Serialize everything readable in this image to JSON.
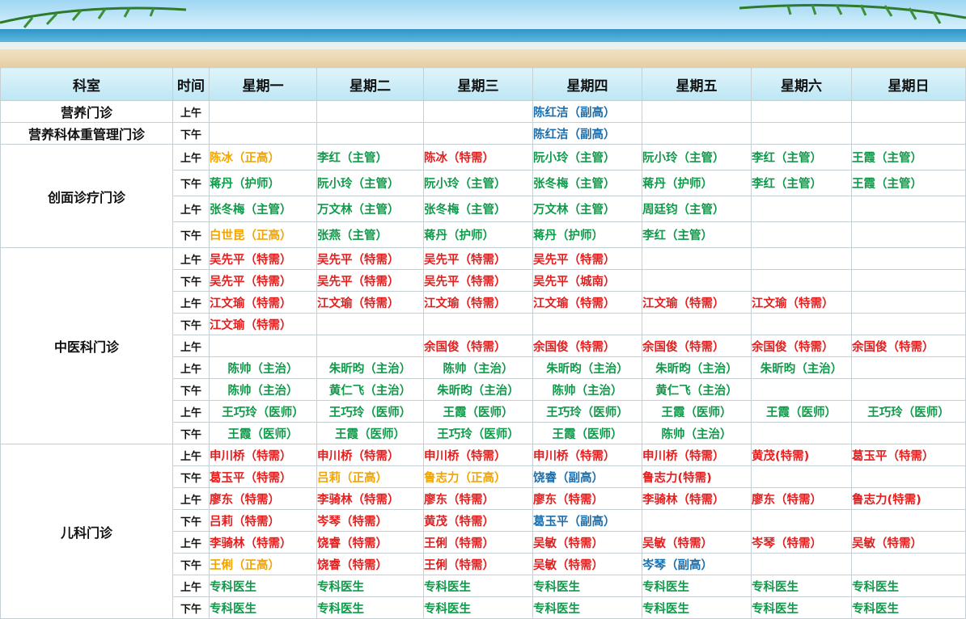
{
  "header": {
    "dept": "科室",
    "time": "时间",
    "days": [
      "星期一",
      "星期二",
      "星期三",
      "星期四",
      "星期五",
      "星期六",
      "星期日"
    ]
  },
  "colors": {
    "red": "#e51e1e",
    "green": "#0f9a4a",
    "gold": "#f2a500",
    "blue": "#1c6fad"
  },
  "departments": [
    {
      "name": "营养门诊",
      "rows": [
        {
          "time": "上午",
          "cells": [
            null,
            null,
            null,
            {
              "t": "陈红洁（副高）",
              "c": "blue"
            },
            null,
            null,
            null
          ]
        }
      ]
    },
    {
      "name": "营养科体重管理门诊",
      "rows": [
        {
          "time": "下午",
          "cells": [
            null,
            null,
            null,
            {
              "t": "陈红洁（副高）",
              "c": "blue"
            },
            null,
            null,
            null
          ]
        }
      ]
    },
    {
      "name": "创面诊疗门诊",
      "rows": [
        {
          "time": "上午",
          "cells": [
            {
              "t": "陈冰（正高）",
              "c": "gold"
            },
            {
              "t": "李红（主管）",
              "c": "green"
            },
            {
              "t": "陈冰（特需）",
              "c": "red"
            },
            {
              "t": "阮小玲（主管）",
              "c": "green"
            },
            {
              "t": "阮小玲（主管）",
              "c": "green"
            },
            {
              "t": "李红（主管）",
              "c": "green"
            },
            {
              "t": "王霞（主管）",
              "c": "green"
            }
          ]
        },
        {
          "time": "下午",
          "cells": [
            {
              "t": "蒋丹（护师）",
              "c": "green"
            },
            {
              "t": "阮小玲（主管）",
              "c": "green"
            },
            {
              "t": "阮小玲（主管）",
              "c": "green"
            },
            {
              "t": "张冬梅（主管）",
              "c": "green"
            },
            {
              "t": "蒋丹（护师）",
              "c": "green"
            },
            {
              "t": "李红（主管）",
              "c": "green"
            },
            {
              "t": "王霞（主管）",
              "c": "green"
            }
          ]
        },
        {
          "time": "上午",
          "cells": [
            {
              "t": "张冬梅（主管）",
              "c": "green"
            },
            {
              "t": "万文林（主管）",
              "c": "green"
            },
            {
              "t": "张冬梅（主管）",
              "c": "green"
            },
            {
              "t": "万文林（主管）",
              "c": "green"
            },
            {
              "t": "周廷钧（主管）",
              "c": "green"
            },
            null,
            null
          ]
        },
        {
          "time": "下午",
          "cells": [
            {
              "t": "白世昆（正高）",
              "c": "gold"
            },
            {
              "t": "张燕（主管）",
              "c": "green"
            },
            {
              "t": "蒋丹（护师）",
              "c": "green"
            },
            {
              "t": "蒋丹（护师）",
              "c": "green"
            },
            {
              "t": "李红（主管）",
              "c": "green"
            },
            null,
            null
          ]
        }
      ]
    },
    {
      "name": "中医科门诊",
      "rows": [
        {
          "time": "上午",
          "cells": [
            {
              "t": "吴先平（特需）",
              "c": "red"
            },
            {
              "t": "吴先平（特需）",
              "c": "red"
            },
            {
              "t": "吴先平（特需）",
              "c": "red"
            },
            {
              "t": "吴先平（特需）",
              "c": "red"
            },
            null,
            null,
            null
          ]
        },
        {
          "time": "下午",
          "cells": [
            {
              "t": "吴先平（特需）",
              "c": "red"
            },
            {
              "t": "吴先平（特需）",
              "c": "red"
            },
            {
              "t": "吴先平（特需）",
              "c": "red"
            },
            {
              "t": "吴先平（城南）",
              "c": "red"
            },
            null,
            null,
            null
          ]
        },
        {
          "time": "上午",
          "cells": [
            {
              "t": "江文瑜（特需）",
              "c": "red"
            },
            {
              "t": "江文瑜（特需）",
              "c": "red"
            },
            {
              "t": "江文瑜（特需）",
              "c": "red"
            },
            {
              "t": "江文瑜（特需）",
              "c": "red"
            },
            {
              "t": "江文瑜（特需）",
              "c": "red"
            },
            {
              "t": "江文瑜（特需）",
              "c": "red"
            },
            null
          ]
        },
        {
          "time": "下午",
          "cells": [
            {
              "t": "江文瑜（特需）",
              "c": "red"
            },
            null,
            null,
            null,
            null,
            null,
            null
          ]
        },
        {
          "time": "上午",
          "cells": [
            null,
            null,
            {
              "t": "余国俊（特需）",
              "c": "red"
            },
            {
              "t": "余国俊（特需）",
              "c": "red"
            },
            {
              "t": "余国俊（特需）",
              "c": "red"
            },
            {
              "t": "余国俊（特需）",
              "c": "red"
            },
            {
              "t": "余国俊（特需）",
              "c": "red"
            }
          ]
        },
        {
          "time": "上午",
          "cells": [
            {
              "t": "陈帅（主治）",
              "c": "green",
              "ctr": true
            },
            {
              "t": "朱昕昀（主治）",
              "c": "green",
              "ctr": true
            },
            {
              "t": "陈帅（主治）",
              "c": "green",
              "ctr": true
            },
            {
              "t": "朱昕昀（主治）",
              "c": "green",
              "ctr": true
            },
            {
              "t": "朱昕昀（主治）",
              "c": "green",
              "ctr": true
            },
            {
              "t": "朱昕昀（主治）",
              "c": "green",
              "ctr": true
            },
            null
          ]
        },
        {
          "time": "下午",
          "cells": [
            {
              "t": "陈帅（主治）",
              "c": "green",
              "ctr": true
            },
            {
              "t": "黄仁飞（主治）",
              "c": "green",
              "ctr": true
            },
            {
              "t": "朱昕昀（主治）",
              "c": "green",
              "ctr": true
            },
            {
              "t": "陈帅（主治）",
              "c": "green",
              "ctr": true
            },
            {
              "t": "黄仁飞（主治）",
              "c": "green",
              "ctr": true
            },
            null,
            null
          ]
        },
        {
          "time": "上午",
          "cells": [
            {
              "t": "王巧玲（医师）",
              "c": "green",
              "ctr": true
            },
            {
              "t": "王巧玲（医师）",
              "c": "green",
              "ctr": true
            },
            {
              "t": "王霞（医师）",
              "c": "green",
              "ctr": true
            },
            {
              "t": "王巧玲（医师）",
              "c": "green",
              "ctr": true
            },
            {
              "t": "王霞（医师）",
              "c": "green",
              "ctr": true
            },
            {
              "t": "王霞（医师）",
              "c": "green",
              "ctr": true
            },
            {
              "t": "王巧玲（医师）",
              "c": "green",
              "ctr": true
            }
          ]
        },
        {
          "time": "下午",
          "cells": [
            {
              "t": "王霞（医师）",
              "c": "green",
              "ctr": true
            },
            {
              "t": "王霞（医师）",
              "c": "green",
              "ctr": true
            },
            {
              "t": "王巧玲（医师）",
              "c": "green",
              "ctr": true
            },
            {
              "t": "王霞（医师）",
              "c": "green",
              "ctr": true
            },
            {
              "t": "陈帅（主治）",
              "c": "green",
              "ctr": true
            },
            null,
            null
          ]
        }
      ]
    },
    {
      "name": "儿科门诊",
      "rows": [
        {
          "time": "上午",
          "cells": [
            {
              "t": "申川桥（特需）",
              "c": "red"
            },
            {
              "t": "申川桥（特需）",
              "c": "red"
            },
            {
              "t": "申川桥（特需）",
              "c": "red"
            },
            {
              "t": "申川桥（特需）",
              "c": "red"
            },
            {
              "t": "申川桥（特需）",
              "c": "red"
            },
            {
              "t": "黄茂(特需)",
              "c": "red"
            },
            {
              "t": "葛玉平（特需）",
              "c": "red"
            }
          ]
        },
        {
          "time": "下午",
          "cells": [
            {
              "t": "葛玉平（特需）",
              "c": "red"
            },
            {
              "t": "吕莉（正高）",
              "c": "gold"
            },
            {
              "t": "鲁志力（正高）",
              "c": "gold"
            },
            {
              "t": "饶睿（副高）",
              "c": "blue"
            },
            {
              "t": "鲁志力(特需)",
              "c": "red"
            },
            null,
            null
          ]
        },
        {
          "time": "上午",
          "cells": [
            {
              "t": "廖东（特需）",
              "c": "red"
            },
            {
              "t": "李骑林（特需）",
              "c": "red"
            },
            {
              "t": "廖东（特需）",
              "c": "red"
            },
            {
              "t": "廖东（特需）",
              "c": "red"
            },
            {
              "t": "李骑林（特需）",
              "c": "red"
            },
            {
              "t": "廖东（特需）",
              "c": "red"
            },
            {
              "t": "鲁志力(特需)",
              "c": "red"
            }
          ]
        },
        {
          "time": "下午",
          "cells": [
            {
              "t": "吕莉（特需）",
              "c": "red"
            },
            {
              "t": "岑琴（特需）",
              "c": "red"
            },
            {
              "t": "黄茂（特需）",
              "c": "red"
            },
            {
              "t": "葛玉平（副高）",
              "c": "blue"
            },
            null,
            null,
            null
          ]
        },
        {
          "time": "上午",
          "cells": [
            {
              "t": "李骑林（特需）",
              "c": "red"
            },
            {
              "t": "饶睿（特需）",
              "c": "red"
            },
            {
              "t": "王俐（特需）",
              "c": "red"
            },
            {
              "t": "吴敏（特需）",
              "c": "red"
            },
            {
              "t": "吴敏（特需）",
              "c": "red"
            },
            {
              "t": "岑琴（特需）",
              "c": "red"
            },
            {
              "t": "吴敏（特需）",
              "c": "red"
            }
          ]
        },
        {
          "time": "下午",
          "cells": [
            {
              "t": "王俐（正高）",
              "c": "gold"
            },
            {
              "t": "饶睿（特需）",
              "c": "red"
            },
            {
              "t": "王俐（特需）",
              "c": "red"
            },
            {
              "t": "吴敏（特需）",
              "c": "red"
            },
            {
              "t": "岑琴（副高）",
              "c": "blue"
            },
            null,
            null
          ]
        },
        {
          "time": "上午",
          "cells": [
            {
              "t": "专科医生",
              "c": "green"
            },
            {
              "t": "专科医生",
              "c": "green"
            },
            {
              "t": "专科医生",
              "c": "green"
            },
            {
              "t": "专科医生",
              "c": "green"
            },
            {
              "t": "专科医生",
              "c": "green"
            },
            {
              "t": "专科医生",
              "c": "green"
            },
            {
              "t": "专科医生",
              "c": "green"
            }
          ]
        },
        {
          "time": "下午",
          "cells": [
            {
              "t": "专科医生",
              "c": "green"
            },
            {
              "t": "专科医生",
              "c": "green"
            },
            {
              "t": "专科医生",
              "c": "green"
            },
            {
              "t": "专科医生",
              "c": "green"
            },
            {
              "t": "专科医生",
              "c": "green"
            },
            {
              "t": "专科医生",
              "c": "green"
            },
            {
              "t": "专科医生",
              "c": "green"
            }
          ]
        }
      ]
    }
  ]
}
